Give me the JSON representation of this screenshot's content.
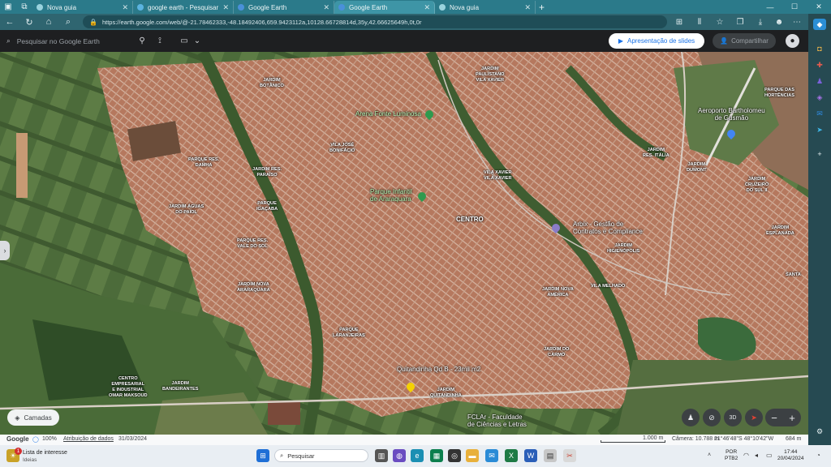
{
  "browser": {
    "tabs": [
      {
        "title": "Nova guia",
        "color": "#9ad3de",
        "active": false
      },
      {
        "title": "google earth - Pesquisar",
        "color": "#5bb3e0",
        "active": false
      },
      {
        "title": "Google Earth",
        "color": "#4a90d9",
        "active": false
      },
      {
        "title": "Google Earth",
        "color": "#4a90d9",
        "active": true
      },
      {
        "title": "Nova guia",
        "color": "#9ad3de",
        "active": false
      }
    ],
    "url": "https://earth.google.com/web/@-21.78462333,-48.18492406,659.9423112a,10128.66728814d,35y,42.66625649h,0t,0r"
  },
  "earth": {
    "search_placeholder": "Pesquisar no Google Earth",
    "slideshow_label": "Apresentação de slides",
    "share_label": "Compartilhar",
    "layers_label": "Camadas",
    "compass_label": "3D"
  },
  "map_labels": {
    "neighborhoods": [
      {
        "text": "JARDIM\nBOTÂNICO"
      },
      {
        "text": "JARDIM\nPAULISTANO\nVILA XAVIER"
      },
      {
        "text": "PARQUE DAS\nHORTÊNCIAS"
      },
      {
        "text": "VILA JOSÉ\nBONIFÁCIO"
      },
      {
        "text": "PARQUE RES.\nDAMHA"
      },
      {
        "text": "JARDIM RES.\nPARAÍSO"
      },
      {
        "text": "VILA XAVIER\nVILA XAVIER"
      },
      {
        "text": "JARDIM\nRES. ITÁLIA"
      },
      {
        "text": "JARDIM\nDUMONT"
      },
      {
        "text": "JARDIM\nCRUZEIRO\nDO SUL II"
      },
      {
        "text": "PARQUE\nIGAÇABA"
      },
      {
        "text": "JARDIM ÁGUAS\nDO PAIOL"
      },
      {
        "text": "JARDIM\nESPLANADA"
      },
      {
        "text": "PARQUE RES.\nVALE DO SOL"
      },
      {
        "text": "JARDIM\nHIGIENÓPOLIS"
      },
      {
        "text": "SANTA"
      },
      {
        "text": "JARDIM NOVA\nARARAQUARA"
      },
      {
        "text": "VILA MELHADO"
      },
      {
        "text": "JARDIM NOVA\nAMÉRICA"
      },
      {
        "text": "PARQUE\nLARANJEIRAS"
      },
      {
        "text": "JARDIM DO\nCARMO"
      },
      {
        "text": "CENTRO\nEMPRESARIAL\nE INDUSTRIAL\nOMAR MAKSOUD"
      },
      {
        "text": "JARDIM\nBANDEIRANTES"
      },
      {
        "text": "JARDIM\nQUITANDINHA"
      }
    ],
    "centro": "CENTRO",
    "pois": [
      {
        "text": "Arena Fonte Luminosa"
      },
      {
        "text": "Parque Infantil\nde Araraquara"
      }
    ],
    "places": [
      {
        "text": "Aeroporto Bartholomeu\nde Gusmão"
      },
      {
        "text": "Arbix - Gestão de\nContratos e Compliance"
      },
      {
        "text": "Quitandinha Qd B - 23mil m2"
      },
      {
        "text": "FCLAr - Faculdade\nde Ciências e Letras"
      }
    ]
  },
  "status": {
    "brand": "Google",
    "zoom": "100%",
    "attribution": "Atribuição de dados",
    "date": "31/03/2024",
    "scale": "1.000 m",
    "camera": "Câmera: 10.788 m",
    "coords": "21°46'48\"S 48°10'42\"W",
    "elevation": "684 m"
  },
  "taskbar": {
    "news_title": "Lista de interesse",
    "news_sub": "Ideias",
    "news_badge": "1",
    "search": "Pesquisar",
    "lang": "POR",
    "layout": "PTB2",
    "time": "17:44",
    "date": "20/04/2024"
  }
}
